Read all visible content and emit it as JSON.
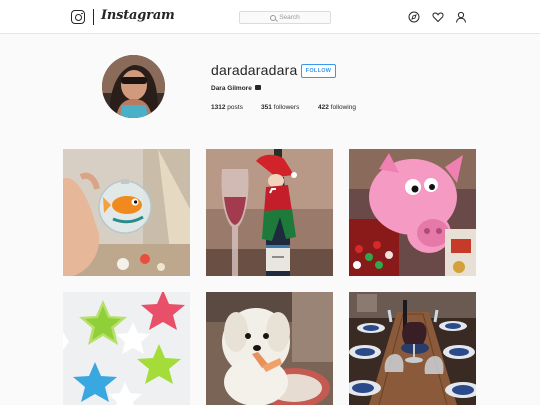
{
  "header": {
    "wordmark": "Instagram",
    "search_placeholder": "Search"
  },
  "profile": {
    "username": "daradaradara",
    "follow_label": "FOLLOW",
    "full_name": "Dara Gilmore",
    "stats": {
      "posts_count": "1312",
      "posts_label": "posts",
      "followers_count": "351",
      "followers_label": "followers",
      "following_count": "422",
      "following_label": "following"
    }
  },
  "icons": {
    "explore": "compass-icon",
    "activity": "heart-icon",
    "profile": "person-icon"
  },
  "colors": {
    "accent": "#3897f0",
    "text": "#262626",
    "background": "#fafafa"
  },
  "posts": [
    {
      "subject": "hand holding glass ornament with orange fish"
    },
    {
      "subject": "elf on the shelf with champagne bottle and glass"
    },
    {
      "subject": "pink pig figurine with candy"
    },
    {
      "subject": "star-shaped candies in bright colors"
    },
    {
      "subject": "fluffy white dog with toy"
    },
    {
      "subject": "dining table set with wine glasses"
    }
  ]
}
